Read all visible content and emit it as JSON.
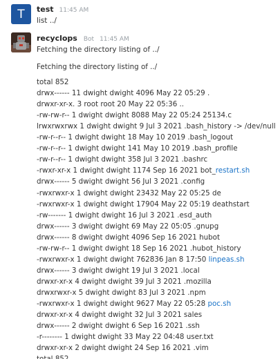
{
  "messages": [
    {
      "author": "test",
      "avatar_letter": "T",
      "time": "11:45 AM",
      "text": "list ../"
    },
    {
      "author": "recyclops",
      "badge": "Bot",
      "time": "11:45 AM",
      "text": "Fetching the directory listing of ../",
      "heading": "Fetching the directory listing of ../",
      "listing": [
        {
          "text": "total 852"
        },
        {
          "text": "drwx------ 11 dwight dwight 4096 May 22 05:29 ."
        },
        {
          "text": "drwxr-xr-x. 3 root root 20 May 22 05:36 .."
        },
        {
          "text": "-rw-rw-r-- 1 dwight dwight 8088 May 22 05:24 25134.c"
        },
        {
          "text": "lrwxrwxrwx 1 dwight dwight 9 Jul 3 2021 .bash_history -> /dev/null"
        },
        {
          "text": "-rw-r--r-- 1 dwight dwight 18 May 10 2019 .bash_logout"
        },
        {
          "text": "-rw-r--r-- 1 dwight dwight 141 May 10 2019 .bash_profile"
        },
        {
          "text": "-rw-r--r-- 1 dwight dwight 358 Jul 3 2021 .bashrc"
        },
        {
          "text": "-rwxr-xr-x 1 dwight dwight 1174 Sep 16 2021 bot_",
          "link": "restart.sh"
        },
        {
          "text": "drwx------ 5 dwight dwight 56 Jul 3 2021 .config"
        },
        {
          "text": "-rwxrwxr-x 1 dwight dwight 23432 May 22 05:25 de"
        },
        {
          "text": "-rwxrwxr-x 1 dwight dwight 17904 May 22 05:19 deathstart"
        },
        {
          "text": "-rw------- 1 dwight dwight 16 Jul 3 2021 .esd_auth"
        },
        {
          "text": "drwx------ 3 dwight dwight 69 May 22 05:05 .gnupg"
        },
        {
          "text": "drwx------ 8 dwight dwight 4096 Sep 16 2021 hubot"
        },
        {
          "text": "-rw-rw-r-- 1 dwight dwight 18 Sep 16 2021 .hubot_history"
        },
        {
          "text": "-rwxrwxr-x 1 dwight dwight 762836 Jan 8 17:50 ",
          "link": "linpeas.sh"
        },
        {
          "text": "drwx------ 3 dwight dwight 19 Jul 3 2021 .local"
        },
        {
          "text": "drwxr-xr-x 4 dwight dwight 39 Jul 3 2021 .mozilla"
        },
        {
          "text": "drwxrwxr-x 5 dwight dwight 83 Jul 3 2021 .npm"
        },
        {
          "text": "-rwxrwxr-x 1 dwight dwight 9627 May 22 05:28 ",
          "link": "poc.sh"
        },
        {
          "text": "drwxr-xr-x 4 dwight dwight 32 Jul 3 2021 sales"
        },
        {
          "text": "drwx------ 2 dwight dwight 6 Sep 16 2021 .ssh"
        },
        {
          "text": "-r-------- 1 dwight dwight 33 May 22 04:48 user.txt"
        },
        {
          "text": "drwxr-xr-x 2 dwight dwight 24 Sep 16 2021 .vim"
        },
        {
          "text": "total 852"
        }
      ]
    }
  ],
  "colors": {
    "avatar_t": "#1e56a0",
    "link": "#1a73c8",
    "meta_text": "#9aa0a6"
  },
  "icons": {
    "bot_avatar": "robot-avatar-icon"
  }
}
